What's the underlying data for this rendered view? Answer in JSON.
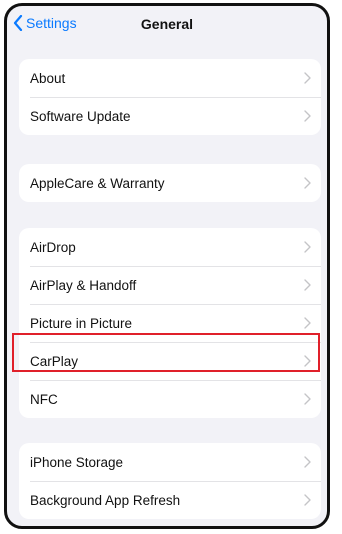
{
  "nav": {
    "back_label": "Settings",
    "title": "General"
  },
  "groups": [
    {
      "rows": [
        {
          "label": "About"
        },
        {
          "label": "Software Update"
        }
      ]
    },
    {
      "rows": [
        {
          "label": "AppleCare & Warranty"
        }
      ]
    },
    {
      "rows": [
        {
          "label": "AirDrop"
        },
        {
          "label": "AirPlay & Handoff"
        },
        {
          "label": "Picture in Picture"
        },
        {
          "label": "CarPlay"
        },
        {
          "label": "NFC"
        }
      ]
    },
    {
      "rows": [
        {
          "label": "iPhone Storage"
        },
        {
          "label": "Background App Refresh"
        }
      ]
    }
  ],
  "highlighted_row": "CarPlay",
  "colors": {
    "accent": "#0a7aff",
    "highlight": "#e0202a",
    "background": "#f2f2f7"
  },
  "icons": {
    "back": "chevron-left-icon",
    "row_chevron": "chevron-right-icon"
  }
}
